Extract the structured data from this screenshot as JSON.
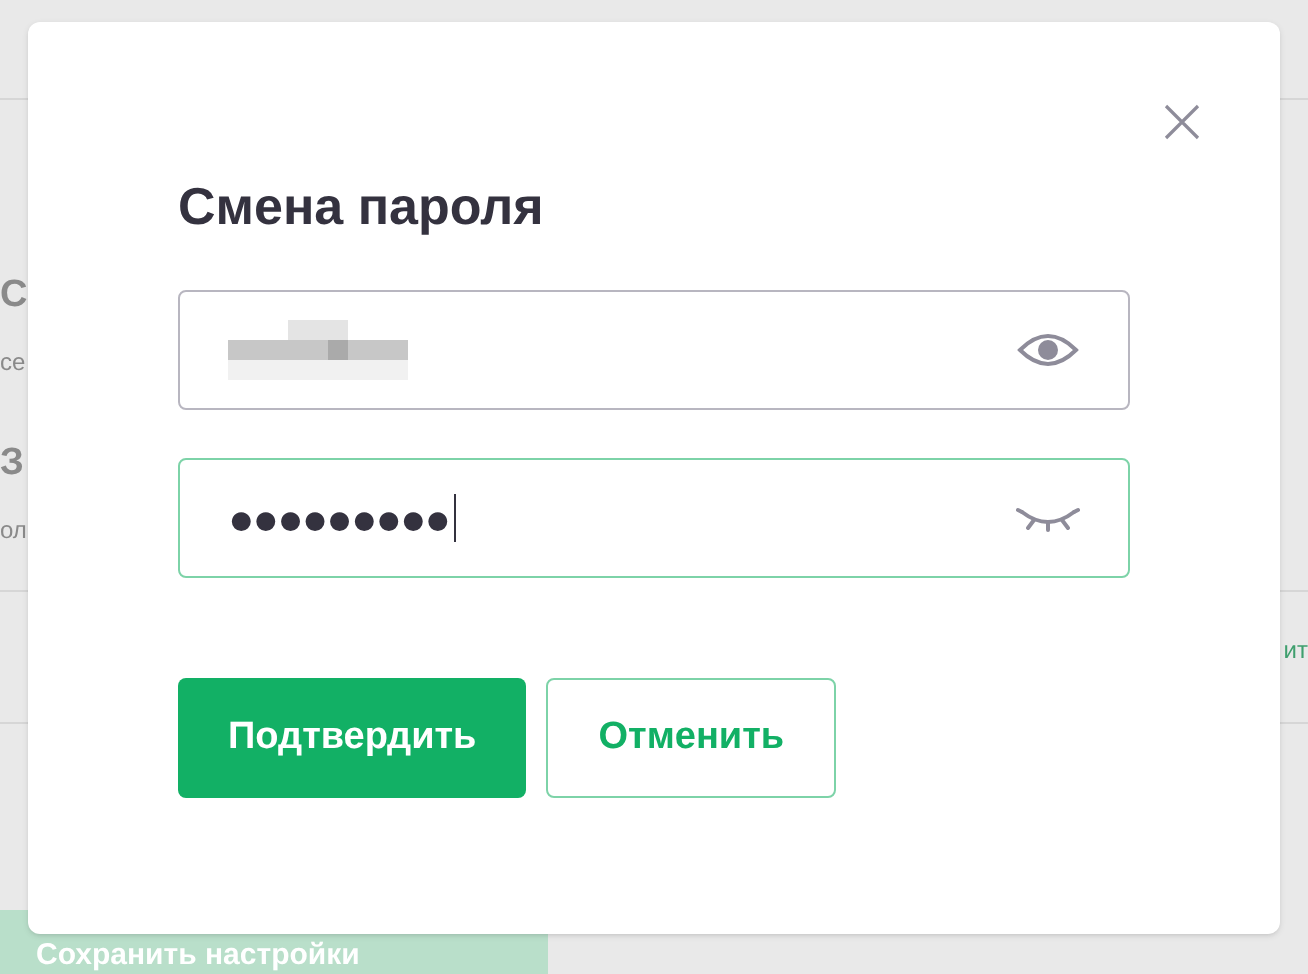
{
  "background": {
    "texts": [
      {
        "kind": "heading",
        "text": "С"
      },
      {
        "kind": "sub",
        "text": "се"
      },
      {
        "kind": "heading",
        "text": "З"
      },
      {
        "kind": "sub",
        "text": "ол"
      }
    ],
    "right_link": "ит",
    "save_button": "Сохранить настройки"
  },
  "dialog": {
    "title": "Смена пароля",
    "fields": [
      {
        "value_redacted": true,
        "revealed": true,
        "focused": false
      },
      {
        "value_redacted": false,
        "value": "●●●●●●●●●",
        "revealed": false,
        "focused": true
      }
    ],
    "buttons": [
      {
        "kind": "primary",
        "label": "Подтвердить"
      },
      {
        "kind": "secondary",
        "label": "Отменить"
      }
    ]
  }
}
